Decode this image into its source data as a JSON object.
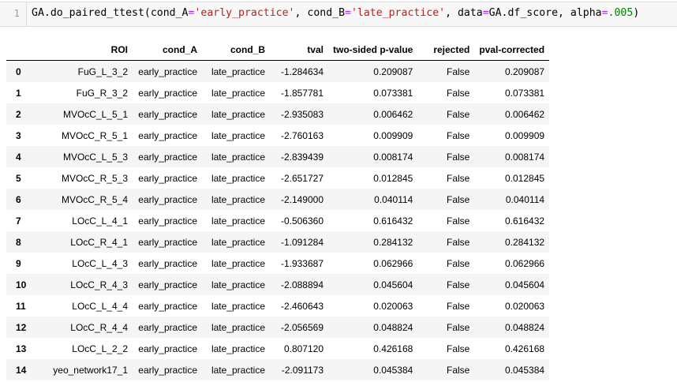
{
  "code_cell": {
    "line_number": "1",
    "tokens": [
      {
        "text": "GA.do_paired_ttest(cond_A",
        "kind": "plain"
      },
      {
        "text": "=",
        "kind": "op"
      },
      {
        "text": "'early_practice'",
        "kind": "string"
      },
      {
        "text": ", cond_B",
        "kind": "plain"
      },
      {
        "text": "=",
        "kind": "op"
      },
      {
        "text": "'late_practice'",
        "kind": "string"
      },
      {
        "text": ", data",
        "kind": "plain"
      },
      {
        "text": "=",
        "kind": "op"
      },
      {
        "text": "GA.df_score, alpha",
        "kind": "plain"
      },
      {
        "text": "=",
        "kind": "op"
      },
      {
        "text": ".005",
        "kind": "num"
      },
      {
        "text": ")",
        "kind": "plain"
      }
    ]
  },
  "colors": {
    "string": "#ba2121",
    "operator": "#aa22ff",
    "number": "#008000",
    "row_stripe": "#f5f5f5"
  },
  "table": {
    "index_header": "",
    "columns": [
      "ROI",
      "cond_A",
      "cond_B",
      "tval",
      "two-sided p-value",
      "rejected",
      "pval-corrected"
    ],
    "rows": [
      {
        "idx": "0",
        "roi": "FuG_L_3_2",
        "cond_a": "early_practice",
        "cond_b": "late_practice",
        "tval": "-1.284634",
        "p": "0.209087",
        "rejected": "False",
        "pc": "0.209087"
      },
      {
        "idx": "1",
        "roi": "FuG_R_3_2",
        "cond_a": "early_practice",
        "cond_b": "late_practice",
        "tval": "-1.857781",
        "p": "0.073381",
        "rejected": "False",
        "pc": "0.073381"
      },
      {
        "idx": "2",
        "roi": "MVOcC_L_5_1",
        "cond_a": "early_practice",
        "cond_b": "late_practice",
        "tval": "-2.935083",
        "p": "0.006462",
        "rejected": "False",
        "pc": "0.006462"
      },
      {
        "idx": "3",
        "roi": "MVOcC_R_5_1",
        "cond_a": "early_practice",
        "cond_b": "late_practice",
        "tval": "-2.760163",
        "p": "0.009909",
        "rejected": "False",
        "pc": "0.009909"
      },
      {
        "idx": "4",
        "roi": "MVOcC_L_5_3",
        "cond_a": "early_practice",
        "cond_b": "late_practice",
        "tval": "-2.839439",
        "p": "0.008174",
        "rejected": "False",
        "pc": "0.008174"
      },
      {
        "idx": "5",
        "roi": "MVOcC_R_5_3",
        "cond_a": "early_practice",
        "cond_b": "late_practice",
        "tval": "-2.651727",
        "p": "0.012845",
        "rejected": "False",
        "pc": "0.012845"
      },
      {
        "idx": "6",
        "roi": "MVOcC_R_5_4",
        "cond_a": "early_practice",
        "cond_b": "late_practice",
        "tval": "-2.149000",
        "p": "0.040114",
        "rejected": "False",
        "pc": "0.040114"
      },
      {
        "idx": "7",
        "roi": "LOcC_L_4_1",
        "cond_a": "early_practice",
        "cond_b": "late_practice",
        "tval": "-0.506360",
        "p": "0.616432",
        "rejected": "False",
        "pc": "0.616432"
      },
      {
        "idx": "8",
        "roi": "LOcC_R_4_1",
        "cond_a": "early_practice",
        "cond_b": "late_practice",
        "tval": "-1.091284",
        "p": "0.284132",
        "rejected": "False",
        "pc": "0.284132"
      },
      {
        "idx": "9",
        "roi": "LOcC_L_4_3",
        "cond_a": "early_practice",
        "cond_b": "late_practice",
        "tval": "-1.933687",
        "p": "0.062966",
        "rejected": "False",
        "pc": "0.062966"
      },
      {
        "idx": "10",
        "roi": "LOcC_R_4_3",
        "cond_a": "early_practice",
        "cond_b": "late_practice",
        "tval": "-2.088894",
        "p": "0.045604",
        "rejected": "False",
        "pc": "0.045604"
      },
      {
        "idx": "11",
        "roi": "LOcC_L_4_4",
        "cond_a": "early_practice",
        "cond_b": "late_practice",
        "tval": "-2.460643",
        "p": "0.020063",
        "rejected": "False",
        "pc": "0.020063"
      },
      {
        "idx": "12",
        "roi": "LOcC_R_4_4",
        "cond_a": "early_practice",
        "cond_b": "late_practice",
        "tval": "-2.056569",
        "p": "0.048824",
        "rejected": "False",
        "pc": "0.048824"
      },
      {
        "idx": "13",
        "roi": "LOcC_L_2_2",
        "cond_a": "early_practice",
        "cond_b": "late_practice",
        "tval": "0.807120",
        "p": "0.426168",
        "rejected": "False",
        "pc": "0.426168"
      },
      {
        "idx": "14",
        "roi": "yeo_network17_1",
        "cond_a": "early_practice",
        "cond_b": "late_practice",
        "tval": "-2.091173",
        "p": "0.045384",
        "rejected": "False",
        "pc": "0.045384"
      }
    ]
  }
}
